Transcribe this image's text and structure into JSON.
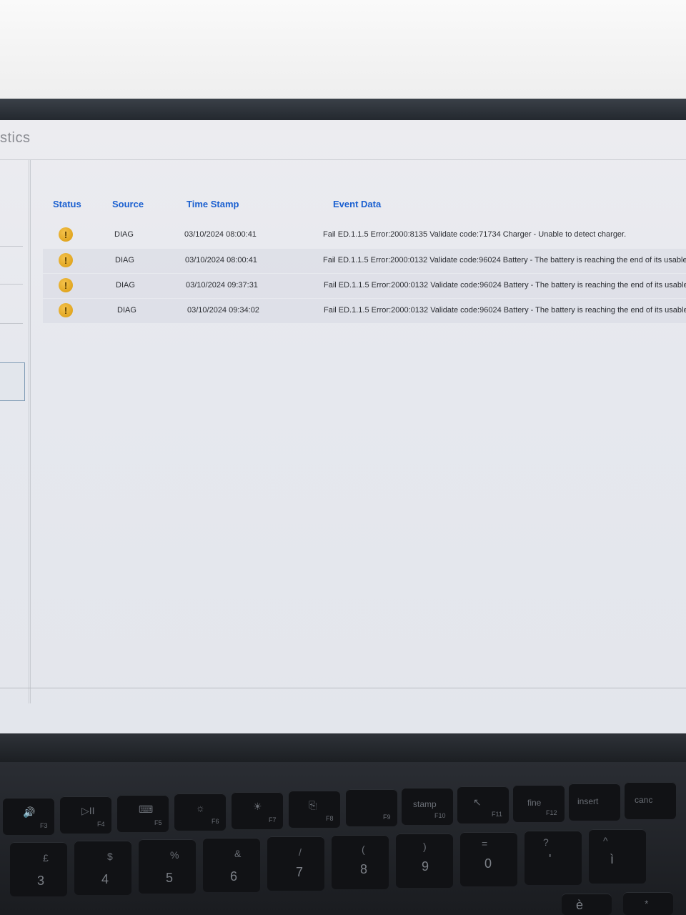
{
  "app": {
    "title_fragment": "stics"
  },
  "table": {
    "headers": {
      "status": "Status",
      "source": "Source",
      "time_stamp": "Time Stamp",
      "event_data": "Event Data"
    },
    "rows": [
      {
        "status": "!",
        "source": "DIAG",
        "time_stamp": "03/10/2024 08:00:41",
        "event_data": "Fail ED.1.1.5 Error:2000:8135  Validate code:71734 Charger - Unable to detect charger."
      },
      {
        "status": "!",
        "source": "DIAG",
        "time_stamp": "03/10/2024 08:00:41",
        "event_data": "Fail ED.1.1.5 Error:2000:0132  Validate code:96024 Battery - The battery is reaching the end of its usable life"
      },
      {
        "status": "!",
        "source": "DIAG",
        "time_stamp": "03/10/2024 09:37:31",
        "event_data": "Fail ED.1.1.5 Error:2000:0132 Validate code:96024 Battery - The battery is reaching the end of its usable life"
      },
      {
        "status": "!",
        "source": "DIAG",
        "time_stamp": "03/10/2024 09:34:02",
        "event_data": "Fail ED.1.1.5 Error:2000:0132 Validate code:96024 Battery - The battery is reaching the end of its usable life"
      }
    ]
  },
  "keyboard": {
    "fkeys": [
      {
        "icon": "🔊",
        "label": "F3"
      },
      {
        "icon": "▷II",
        "label": "F4"
      },
      {
        "icon": "⌨",
        "label": "F5"
      },
      {
        "icon": "☼",
        "label": "F6"
      },
      {
        "icon": "☀",
        "label": "F7"
      },
      {
        "icon": "⎘",
        "label": "F8"
      },
      {
        "icon": "",
        "label": "F9"
      },
      {
        "icon": "stamp",
        "label": "F10"
      },
      {
        "icon": "↖",
        "label": "F11"
      },
      {
        "icon": "fine",
        "label": "F12"
      },
      {
        "icon": "insert",
        "label": ""
      },
      {
        "icon": "canc",
        "label": ""
      }
    ],
    "number_keys": [
      {
        "top": "£",
        "main": "3"
      },
      {
        "top": "$",
        "main": "4"
      },
      {
        "top": "%",
        "main": "5"
      },
      {
        "top": "&",
        "main": "6"
      },
      {
        "top": "/",
        "main": "7"
      },
      {
        "top": "(",
        "main": "8"
      },
      {
        "top": ")",
        "main": "9"
      },
      {
        "top": "=",
        "main": "0"
      },
      {
        "top": "?",
        "main": "'"
      },
      {
        "top": "^",
        "main": "ì"
      }
    ],
    "extra": {
      "e_grave": "è",
      "star": "*"
    }
  },
  "colors": {
    "header_text": "#1a5fd0",
    "warning": "#e0a520"
  },
  "icons": {
    "status": "warning-icon"
  }
}
